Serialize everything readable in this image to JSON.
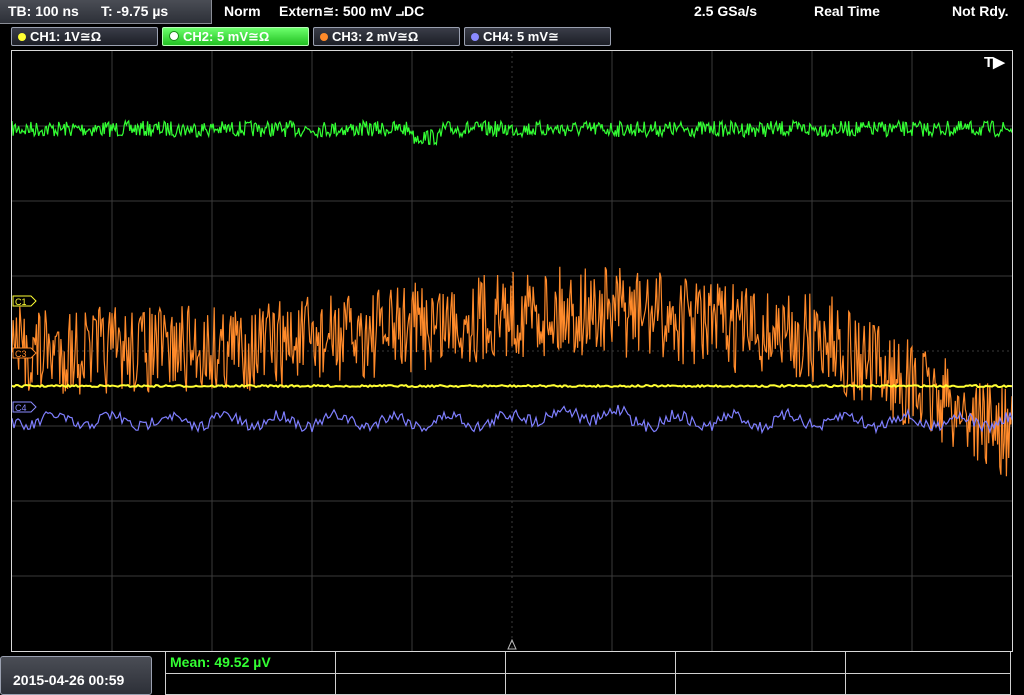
{
  "status": {
    "timebase": "TB: 100 ns",
    "trigger_time": "T: -9.75 µs",
    "mode": "Norm",
    "trigger_source": "Extern≅: 500 mV ⨼DC",
    "sample_rate": "2.5 GSa/s",
    "acq_mode": "Real Time",
    "state": "Not Rdy."
  },
  "channels": [
    {
      "label": "CH1: 1V≅Ω",
      "color": "#ffff33",
      "active": false
    },
    {
      "label": "CH2: 5 mV≅Ω",
      "color": "#33ff33",
      "active": true
    },
    {
      "label": "CH3: 2 mV≅Ω",
      "color": "#ff8a2a",
      "active": false
    },
    {
      "label": "CH4: 5 mV≅",
      "color": "#8a8aff",
      "active": false
    }
  ],
  "plot": {
    "trigger_marker": "T▶",
    "markers": {
      "c1": "C1",
      "c3": "C3",
      "c4": "C4"
    },
    "grid": {
      "h_div": 10,
      "v_div": 8
    }
  },
  "footer": {
    "datetime": "2015-04-26 00:59",
    "measurement": "Mean: 49.52 µV"
  }
}
